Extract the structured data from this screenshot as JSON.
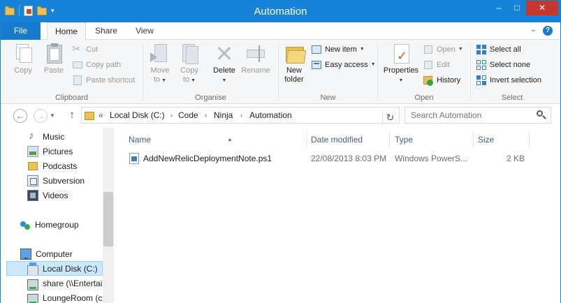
{
  "window": {
    "title": "Automation",
    "controls": {
      "minimize": "–",
      "maximize": "□",
      "close": "✕"
    }
  },
  "tabs": {
    "file": "File",
    "home": "Home",
    "share": "Share",
    "view": "View",
    "collapse_icon": "chevron-down-icon",
    "help": "?"
  },
  "ribbon": {
    "clipboard": {
      "label": "Clipboard",
      "copy": "Copy",
      "paste": "Paste",
      "cut": "Cut",
      "copy_path": "Copy path",
      "paste_shortcut": "Paste shortcut"
    },
    "organise": {
      "label": "Organise",
      "move_to": [
        "Move",
        "to"
      ],
      "copy_to": [
        "Copy",
        "to"
      ],
      "delete": "Delete",
      "rename": "Rename"
    },
    "new": {
      "label": "New",
      "new_folder": [
        "New",
        "folder"
      ],
      "new_item": "New item",
      "easy_access": "Easy access"
    },
    "open": {
      "label": "Open",
      "properties": "Properties",
      "open": "Open",
      "edit": "Edit",
      "history": "History"
    },
    "select": {
      "label": "Select",
      "select_all": "Select all",
      "select_none": "Select none",
      "invert_selection": "Invert selection"
    }
  },
  "navigation": {
    "path_prefix": "«",
    "breadcrumb": [
      "Local Disk (C:)",
      "Code",
      "Ninja",
      "Automation"
    ],
    "search_placeholder": "Search Automation"
  },
  "sidebar": {
    "items": [
      {
        "label": "Music",
        "icon": "music-icon"
      },
      {
        "label": "Pictures",
        "icon": "pictures-icon"
      },
      {
        "label": "Podcasts",
        "icon": "folder-icon"
      },
      {
        "label": "Subversion",
        "icon": "subversion-icon"
      },
      {
        "label": "Videos",
        "icon": "videos-icon"
      },
      {
        "label": "Homegroup",
        "icon": "homegroup-icon"
      },
      {
        "label": "Computer",
        "icon": "computer-icon"
      },
      {
        "label": "Local Disk (C:)",
        "icon": "disk-icon",
        "selected": true
      },
      {
        "label": "share (\\\\Entertai",
        "icon": "network-drive-icon"
      },
      {
        "label": "LoungeRoom (c",
        "icon": "network-drive-icon"
      }
    ]
  },
  "file_list": {
    "columns": [
      "Name",
      "Date modified",
      "Type",
      "Size"
    ],
    "rows": [
      {
        "name": "AddNewRelicDeploymentNote.ps1",
        "date_modified": "22/08/2013 8:03 PM",
        "type": "Windows PowerS...",
        "size": "2 KB"
      }
    ]
  },
  "colors": {
    "titlebar": "#1683d8",
    "file_tab": "#1979ca",
    "close_button": "#c7372d",
    "selected_item": "#cce8ff",
    "ribbon_bg": "#f5f6f7"
  }
}
